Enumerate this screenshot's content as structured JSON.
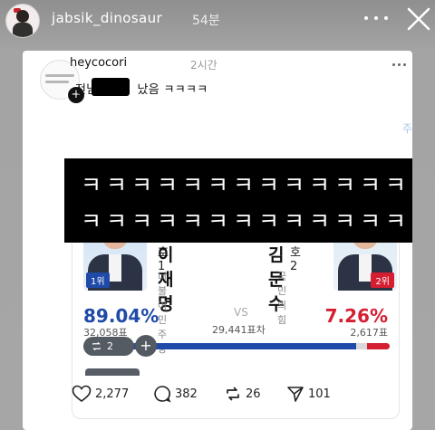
{
  "story": {
    "username": "jabsik_dinosaur",
    "time": "54분"
  },
  "post": {
    "username": "heycocori",
    "time": "2시간",
    "text_prefix": "전남",
    "text_suffix": "났음 ㅋㅋㅋㅋ",
    "follow_plus": "+",
    "redacted_overlay_rows": [
      "ㅋㅋㅋㅋㅋㅋㅋㅋㅋㅋㅋㅋㅋ",
      "ㅋㅋㅋㅋㅋㅋㅋㅋㅋㅋㅋㅋㅋ"
    ],
    "behind_overlay_char": "주"
  },
  "embed": {
    "left": {
      "number_label": "기호 1",
      "name": "이재명",
      "party": "더불어민주당",
      "rank": "1위",
      "percent": "89.04%",
      "votes": "32,058표",
      "share": 0.8904,
      "color": "#1f4aa8"
    },
    "right": {
      "number_label": "기호 2",
      "name": "김문수",
      "party": "국민의힘",
      "rank": "2위",
      "percent": "7.26%",
      "votes": "2,617표",
      "share": 0.0726,
      "color": "#d51e32"
    },
    "vs": "VS",
    "margin": "29,441표차",
    "repost_pill": "2",
    "plus_button": "+"
  },
  "actions": {
    "likes": "2,277",
    "comments": "382",
    "reposts": "26",
    "shares": "101"
  }
}
